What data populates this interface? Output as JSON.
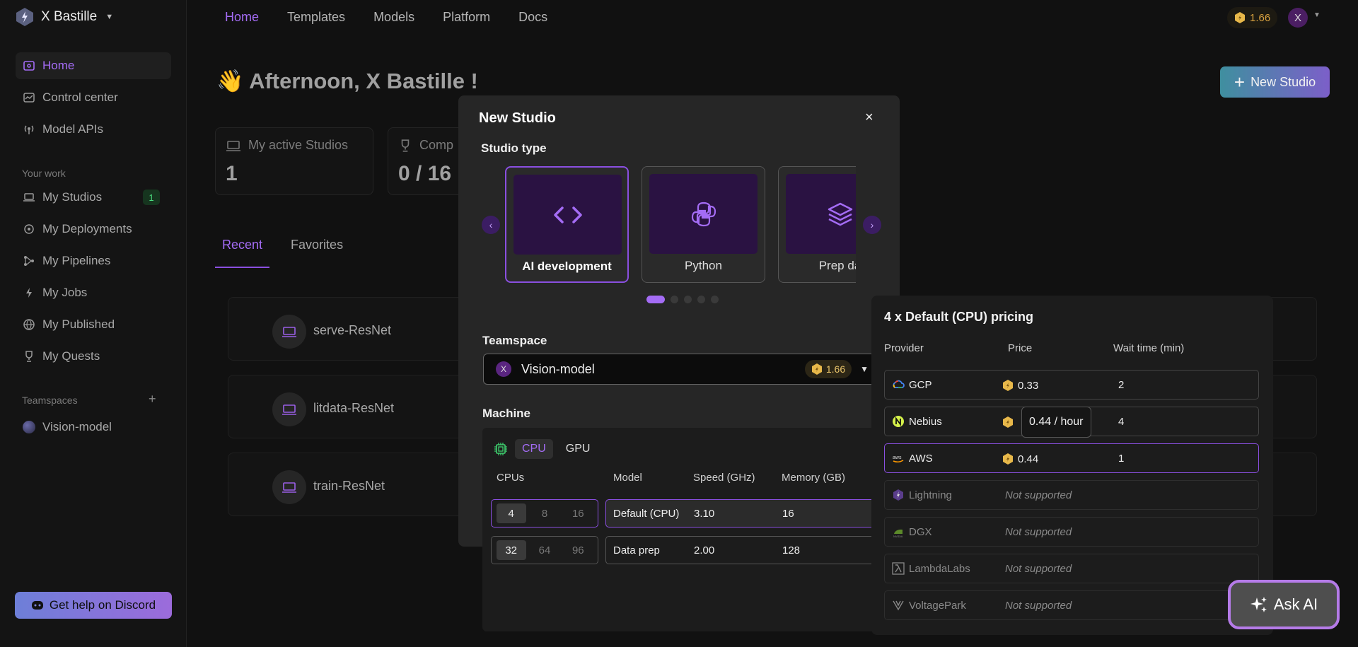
{
  "brand": {
    "name": "X Bastille"
  },
  "sidebar": {
    "main_items": [
      {
        "label": "Home",
        "icon": "home-icon"
      },
      {
        "label": "Control center",
        "icon": "control-center-icon"
      },
      {
        "label": "Model APIs",
        "icon": "broadcast-icon"
      }
    ],
    "your_work_label": "Your work",
    "work_items": [
      {
        "label": "My Studios",
        "badge": "1"
      },
      {
        "label": "My Deployments"
      },
      {
        "label": "My Pipelines"
      },
      {
        "label": "My Jobs"
      },
      {
        "label": "My Published"
      },
      {
        "label": "My Quests"
      }
    ],
    "teamspaces_label": "Teamspaces",
    "teamspace_plus": "+",
    "teamspace_item": "Vision-model",
    "discord_label": "Get help on Discord"
  },
  "topnav": {
    "items": [
      "Home",
      "Templates",
      "Models",
      "Platform",
      "Docs"
    ]
  },
  "account": {
    "credits": "1.66",
    "avatar_letter": "X"
  },
  "main": {
    "greeting": "Afternoon, X Bastille !",
    "greeting_emoji": "👋",
    "new_studio_label": "New Studio",
    "stats": [
      {
        "label": "My active Studios",
        "value": "1"
      },
      {
        "label": "Comp",
        "value": "0 / 16"
      }
    ],
    "tabs": [
      "Recent",
      "Favorites"
    ],
    "recent": [
      "serve-ResNet",
      "litdata-ResNet",
      "train-ResNet"
    ]
  },
  "modal": {
    "title": "New Studio",
    "close": "×",
    "studio_type_label": "Studio type",
    "studio_types": [
      "AI development",
      "Python",
      "Prep da"
    ],
    "teamspace_label": "Teamspace",
    "teamspace": {
      "avatar_letter": "X",
      "name": "Vision-model",
      "credits": "1.66"
    },
    "machine_label": "Machine",
    "machine_tabs": [
      "CPU",
      "GPU"
    ],
    "columns": [
      "CPUs",
      "Model",
      "Speed (GHz)",
      "Memory (GB)"
    ],
    "cpu_rows": [
      {
        "cpus": [
          "4",
          "8",
          "16"
        ],
        "model": "Default (CPU)",
        "speed": "3.10",
        "memory": "16"
      },
      {
        "cpus": [
          "32",
          "64",
          "96"
        ],
        "model": "Data prep",
        "speed": "2.00",
        "memory": "128"
      }
    ]
  },
  "pricing": {
    "title": "4 x Default (CPU) pricing",
    "headers": [
      "Provider",
      "Price",
      "Wait time (min)"
    ],
    "providers": [
      {
        "name": "GCP",
        "price": "0.33",
        "wait": "2"
      },
      {
        "name": "Nebius",
        "price": "",
        "wait": "4"
      },
      {
        "name": "AWS",
        "price": "0.44",
        "wait": "1"
      },
      {
        "name": "Lightning",
        "status": "Not supported"
      },
      {
        "name": "DGX",
        "status": "Not supported"
      },
      {
        "name": "LambdaLabs",
        "status": "Not supported"
      },
      {
        "name": "VoltagePark",
        "status": "Not supported"
      }
    ],
    "tooltip": "0.44 / hour"
  },
  "ask_ai_label": "Ask AI",
  "colors": {
    "accent": "#a46cf5",
    "coin": "#e8b84a",
    "background": "#111111"
  }
}
